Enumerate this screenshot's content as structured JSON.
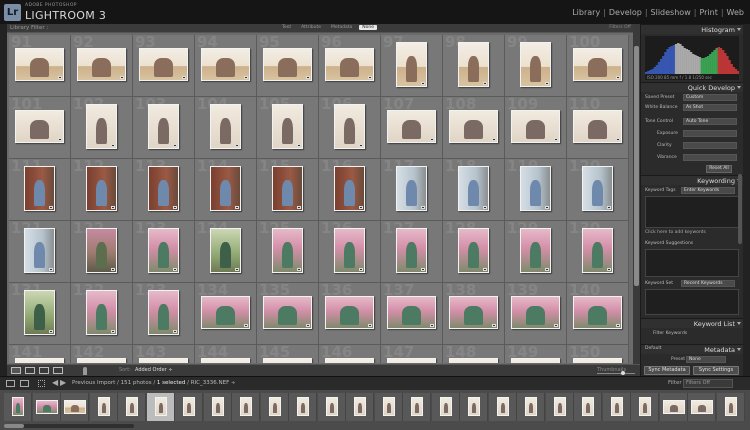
{
  "app": {
    "logo": "Lr",
    "vendor": "ADOBE PHOTOSHOP",
    "name": "LIGHTROOM 3",
    "modules": [
      {
        "label": "Library",
        "active": true
      },
      {
        "label": "Develop",
        "active": false
      },
      {
        "label": "Slideshow",
        "active": false
      },
      {
        "label": "Print",
        "active": false
      },
      {
        "label": "Web",
        "active": false
      }
    ],
    "module_separator": "|"
  },
  "filter_bar": {
    "title": "Library Filter :",
    "options": [
      {
        "label": "Text",
        "active": false
      },
      {
        "label": "Attribute",
        "active": false
      },
      {
        "label": "Metadata",
        "active": false
      },
      {
        "label": "None",
        "active": true
      }
    ],
    "preset": "Filters Off ÷"
  },
  "grid": {
    "cells": [
      {
        "idx": "91",
        "o": "land",
        "t": "living"
      },
      {
        "idx": "92",
        "o": "land",
        "t": "living"
      },
      {
        "idx": "93",
        "o": "land",
        "t": "living"
      },
      {
        "idx": "94",
        "o": "land",
        "t": "living"
      },
      {
        "idx": "95",
        "o": "land",
        "t": "living"
      },
      {
        "idx": "96",
        "o": "land",
        "t": "living"
      },
      {
        "idx": "97",
        "o": "port",
        "t": "living"
      },
      {
        "idx": "98",
        "o": "port",
        "t": "living"
      },
      {
        "idx": "99",
        "o": "port",
        "t": "living"
      },
      {
        "idx": "100",
        "o": "land",
        "t": "living"
      },
      {
        "idx": "101",
        "o": "land",
        "t": "light"
      },
      {
        "idx": "102",
        "o": "port",
        "t": "light"
      },
      {
        "idx": "103",
        "o": "port",
        "t": "light"
      },
      {
        "idx": "104",
        "o": "port",
        "t": "light"
      },
      {
        "idx": "105",
        "o": "port",
        "t": "light"
      },
      {
        "idx": "106",
        "o": "port",
        "t": "light"
      },
      {
        "idx": "107",
        "o": "land",
        "t": "light"
      },
      {
        "idx": "108",
        "o": "land",
        "t": "light"
      },
      {
        "idx": "109",
        "o": "land",
        "t": "light"
      },
      {
        "idx": "110",
        "o": "land",
        "t": "light"
      },
      {
        "idx": "111",
        "o": "port",
        "t": "brick"
      },
      {
        "idx": "112",
        "o": "port",
        "t": "brick"
      },
      {
        "idx": "113",
        "o": "port",
        "t": "brick"
      },
      {
        "idx": "114",
        "o": "port",
        "t": "brick"
      },
      {
        "idx": "115",
        "o": "port",
        "t": "brick"
      },
      {
        "idx": "116",
        "o": "port",
        "t": "brick"
      },
      {
        "idx": "117",
        "o": "port",
        "t": "window"
      },
      {
        "idx": "118",
        "o": "port",
        "t": "window"
      },
      {
        "idx": "119",
        "o": "port",
        "t": "window"
      },
      {
        "idx": "120",
        "o": "port",
        "t": "window"
      },
      {
        "idx": "121",
        "o": "port",
        "t": "window"
      },
      {
        "idx": "122",
        "o": "port",
        "t": "tree"
      },
      {
        "idx": "123",
        "o": "port",
        "t": "blossom"
      },
      {
        "idx": "124",
        "o": "port",
        "t": "green"
      },
      {
        "idx": "125",
        "o": "port",
        "t": "blossom"
      },
      {
        "idx": "126",
        "o": "port",
        "t": "blossom"
      },
      {
        "idx": "127",
        "o": "port",
        "t": "blossom"
      },
      {
        "idx": "128",
        "o": "port",
        "t": "blossom"
      },
      {
        "idx": "129",
        "o": "port",
        "t": "blossom"
      },
      {
        "idx": "130",
        "o": "port",
        "t": "blossom"
      },
      {
        "idx": "131",
        "o": "port",
        "t": "green"
      },
      {
        "idx": "132",
        "o": "port",
        "t": "blossom"
      },
      {
        "idx": "133",
        "o": "port",
        "t": "blossom"
      },
      {
        "idx": "134",
        "o": "land",
        "t": "blossom"
      },
      {
        "idx": "135",
        "o": "land",
        "t": "blossom"
      },
      {
        "idx": "136",
        "o": "land",
        "t": "blossom"
      },
      {
        "idx": "137",
        "o": "land",
        "t": "blossom"
      },
      {
        "idx": "138",
        "o": "land",
        "t": "blossom"
      },
      {
        "idx": "139",
        "o": "land",
        "t": "blossom"
      },
      {
        "idx": "140",
        "o": "land",
        "t": "blossom"
      },
      {
        "idx": "141",
        "o": "land",
        "t": "living"
      },
      {
        "idx": "142",
        "o": "land",
        "t": "living"
      },
      {
        "idx": "143",
        "o": "land",
        "t": "living"
      },
      {
        "idx": "144",
        "o": "land",
        "t": "living"
      },
      {
        "idx": "145",
        "o": "land",
        "t": "living"
      },
      {
        "idx": "146",
        "o": "land",
        "t": "living"
      },
      {
        "idx": "147",
        "o": "land",
        "t": "living"
      },
      {
        "idx": "148",
        "o": "land",
        "t": "living"
      },
      {
        "idx": "149",
        "o": "land",
        "t": "living"
      },
      {
        "idx": "150",
        "o": "land",
        "t": "living"
      }
    ]
  },
  "toolbar": {
    "sort_label": "Sort:",
    "sort_value": "Added Order ÷",
    "thumbnails_label": "Thumbnails"
  },
  "right_panel": {
    "histogram": {
      "title": "Histogram",
      "stats": "ISO 200   85 mm   f / 1.8   1/250 sec",
      "bars": [
        2,
        3,
        4,
        5,
        7,
        9,
        12,
        15,
        18,
        22,
        25,
        27,
        28,
        29,
        30,
        31,
        30,
        28,
        26,
        25,
        24,
        22,
        20,
        19,
        18,
        17,
        16,
        16,
        17,
        18,
        20,
        22,
        24,
        26,
        27,
        26,
        24,
        21,
        18,
        14,
        10,
        7,
        5,
        3
      ],
      "colors": [
        "#3a5fc8",
        "#3fb35a",
        "#d33a3a",
        "#bdbdbd"
      ]
    },
    "quick_develop": {
      "title": "Quick Develop",
      "rows": [
        {
          "label": "Saved Preset",
          "value": "Custom"
        },
        {
          "label": "White Balance",
          "value": "As Shot"
        },
        {
          "label": "Tone Control",
          "value": "Auto Tone"
        },
        {
          "label": "Exposure",
          "value": ""
        },
        {
          "label": "Clarity",
          "value": ""
        },
        {
          "label": "Vibrance",
          "value": ""
        }
      ],
      "reset_label": "Reset All"
    },
    "keywording": {
      "title": "Keywording",
      "tags_label": "Keyword Tags",
      "tags_value": "Enter Keywords",
      "hint": "Click here to add keywords",
      "suggestions_label": "Keyword Suggestions",
      "set_label": "Keyword Set",
      "set_value": "Recent Keywords"
    },
    "keyword_list": {
      "title": "Keyword List",
      "filter": "Filter Keywords"
    },
    "metadata": {
      "title": "Metadata",
      "preset_label": "Default",
      "preset_value": "Preset",
      "preset_value2": "None"
    },
    "buttons": {
      "sync_metadata": "Sync Metadata",
      "sync_settings": "Sync Settings"
    }
  },
  "filmstrip_bar": {
    "source": "Previous Import / 151 photos /",
    "selected": "1 selected",
    "filename": "/ RIC_3336.NEF ÷",
    "filter_label": "Filter :",
    "filter_value": "Filters Off"
  },
  "filmstrip": {
    "items": [
      {
        "o": "port",
        "t": "blossom"
      },
      {
        "o": "land",
        "t": "blossom"
      },
      {
        "o": "land",
        "t": "living"
      },
      {
        "o": "port",
        "t": "light"
      },
      {
        "o": "port",
        "t": "light"
      },
      {
        "o": "port",
        "t": "light",
        "sel": true
      },
      {
        "o": "port",
        "t": "light"
      },
      {
        "o": "port",
        "t": "light"
      },
      {
        "o": "port",
        "t": "light"
      },
      {
        "o": "port",
        "t": "light"
      },
      {
        "o": "port",
        "t": "light"
      },
      {
        "o": "port",
        "t": "light"
      },
      {
        "o": "port",
        "t": "light"
      },
      {
        "o": "port",
        "t": "light"
      },
      {
        "o": "port",
        "t": "light"
      },
      {
        "o": "port",
        "t": "light"
      },
      {
        "o": "port",
        "t": "light"
      },
      {
        "o": "port",
        "t": "light"
      },
      {
        "o": "port",
        "t": "light"
      },
      {
        "o": "port",
        "t": "light"
      },
      {
        "o": "port",
        "t": "light"
      },
      {
        "o": "port",
        "t": "light"
      },
      {
        "o": "port",
        "t": "light"
      },
      {
        "o": "land",
        "t": "light"
      },
      {
        "o": "land",
        "t": "light"
      },
      {
        "o": "port",
        "t": "light"
      }
    ]
  }
}
